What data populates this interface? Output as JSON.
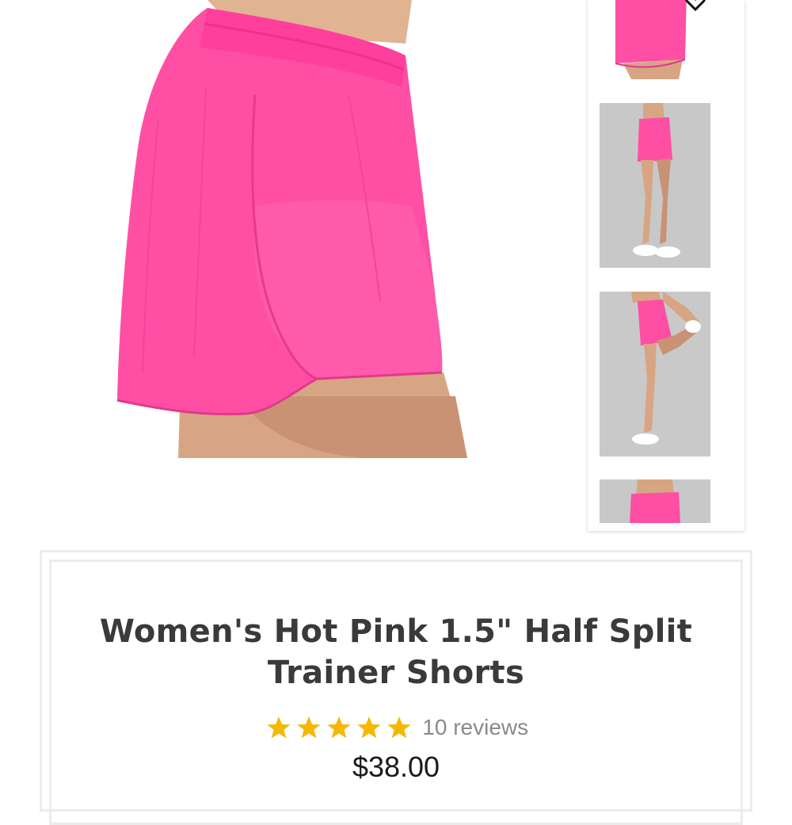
{
  "product": {
    "title": "Women's Hot Pink 1.5\" Half Split Trainer Shorts",
    "rating_stars": 5,
    "review_count": "10 reviews",
    "price": "$38.00"
  },
  "colors": {
    "shorts_pink": "#ff4fa4",
    "star_gold": "#f5b800",
    "photo_bg_gray": "#c8c8c8",
    "title_text": "#3a3a3a"
  },
  "gallery": {
    "thumbnail_count": 4,
    "icons": [
      "heart-icon"
    ]
  }
}
